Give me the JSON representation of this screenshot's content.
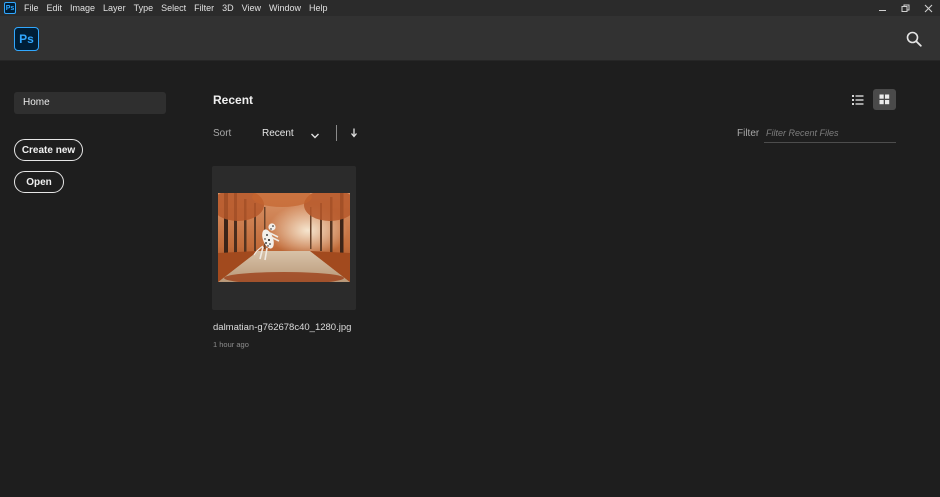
{
  "menubar": {
    "app_icon_text": "Ps",
    "items": [
      "File",
      "Edit",
      "Image",
      "Layer",
      "Type",
      "Select",
      "Filter",
      "3D",
      "View",
      "Window",
      "Help"
    ],
    "window_controls": [
      "minimize-icon",
      "restore-icon",
      "close-icon"
    ]
  },
  "header": {
    "logo_text": "Ps",
    "search_icon": "search-icon"
  },
  "sidebar": {
    "home_label": "Home",
    "create_new_label": "Create new",
    "open_label": "Open"
  },
  "main": {
    "section_title": "Recent",
    "sort": {
      "label": "Sort",
      "value": "Recent",
      "dropdown_icon": "chevron-down-icon",
      "direction_icon": "arrow-down-icon"
    },
    "view_modes": {
      "list_icon": "list-view-icon",
      "grid_icon": "grid-view-icon",
      "active": "grid"
    },
    "filter": {
      "label": "Filter",
      "placeholder": "Filter Recent Files",
      "value": ""
    },
    "files": [
      {
        "name": "dalmatian-g762678c40_1280.jpg",
        "time": "1 hour ago",
        "thumbnail": "dalmatian-in-autumn-forest"
      }
    ]
  },
  "colors": {
    "background": "#1e1e1e",
    "header": "#323232",
    "menubar": "#2b2b2b",
    "brand": "#31a8ff",
    "brand_dark": "#001e36"
  }
}
